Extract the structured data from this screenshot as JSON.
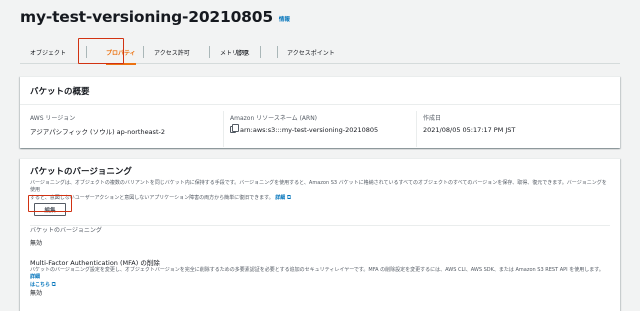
{
  "bucket": {
    "name": "my-test-versioning-20210805",
    "info_link": "情報"
  },
  "tabs": [
    {
      "label": "オブジェクト"
    },
    {
      "label": "プロパティ",
      "active": true
    },
    {
      "label": "アクセス許可"
    },
    {
      "label": "メトリクス"
    },
    {
      "label": "管理"
    },
    {
      "label": "アクセスポイント"
    }
  ],
  "overview": {
    "heading": "バケットの概要",
    "region_label": "AWS リージョン",
    "region_value": "アジアパシフィック (ソウル) ap-northeast-2",
    "arn_label": "Amazon リソースネーム (ARN)",
    "arn_value": "arn:aws:s3:::my-test-versioning-20210805",
    "created_label": "作成日",
    "created_value": "2021/08/05 05:17:17 PM JST"
  },
  "versioning": {
    "heading": "バケットのバージョニング",
    "desc_line1": "バージョニングは、オブジェクトの複数のバリアントを同じバケット内に保持する手段です。バージョニングを使用すると、Amazon S3 バケットに格納されているすべてのオブジェクトのすべてのバージョンを保存、取得、復元できます。バージョニングを使用",
    "desc_line2": "すると、意図しないユーザーアクションと意図しないアプリケーション障害の両方から簡単に復旧できます。",
    "desc_link": "詳細",
    "edit_label": "編集",
    "field_label": "バケットのバージョニング",
    "field_value": "無効",
    "mfa_title": "Multi-Factor Authentication (MFA) の削除",
    "mfa_desc_line1": "バケットのバージョニング設定を変更し、オブジェクトバージョンを完全に削除するための多要素認証を必要とする追加のセキュリティレイヤーです。MFA の削除設定を変更するには、AWS CLI、AWS SDK、または Amazon S3 REST API を使用します。",
    "mfa_desc_link1": "詳細",
    "mfa_desc_link2": "はこちら",
    "mfa_value": "無効"
  },
  "colors": {
    "accent": "#ec7211",
    "link": "#0073bb",
    "highlight": "#d13212"
  }
}
